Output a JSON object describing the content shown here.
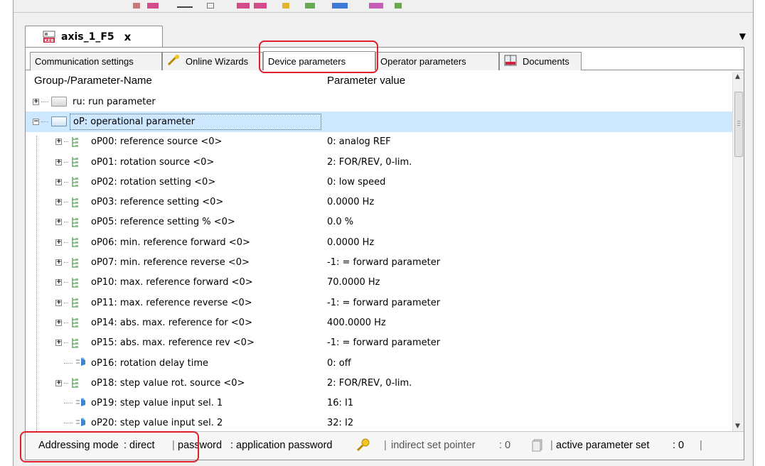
{
  "document_tab": {
    "title": "axis_1_F5",
    "close_glyph": "x",
    "dropdown_glyph": "▼",
    "logo_text": "KEB"
  },
  "subtabs": [
    {
      "label": "Communication settings",
      "icon": "none"
    },
    {
      "label": "Online Wizards",
      "icon": "wand-icon"
    },
    {
      "label": "Device parameters",
      "icon": "none",
      "active": true
    },
    {
      "label": "Operator parameters",
      "icon": "none"
    },
    {
      "label": "Documents",
      "icon": "keb-book-icon"
    }
  ],
  "grid": {
    "col_name": "Group-/Parameter-Name",
    "col_value": "Parameter value",
    "rows": [
      {
        "name": "ru: run parameter",
        "value": "",
        "kind": "group",
        "expanded": false
      },
      {
        "name": "oP: operational parameter",
        "value": "",
        "kind": "group",
        "expanded": true,
        "selected": true
      },
      {
        "name": "oP00: reference source <0>",
        "value": "0: analog REF",
        "kind": "param"
      },
      {
        "name": "oP01: rotation source <0>",
        "value": "2: FOR/REV, 0-lim.",
        "kind": "param"
      },
      {
        "name": "oP02: rotation setting <0>",
        "value": "0: low speed",
        "kind": "param"
      },
      {
        "name": "oP03: reference setting <0>",
        "value": "0.0000 Hz",
        "kind": "param"
      },
      {
        "name": "oP05: reference setting % <0>",
        "value": "0.0 %",
        "kind": "param"
      },
      {
        "name": "oP06: min. reference forward <0>",
        "value": "0.0000 Hz",
        "kind": "param"
      },
      {
        "name": "oP07: min. reference reverse <0>",
        "value": "-1: = forward parameter",
        "kind": "param"
      },
      {
        "name": "oP10: max. reference forward <0>",
        "value": "70.0000 Hz",
        "kind": "param"
      },
      {
        "name": "oP11: max. reference reverse <0>",
        "value": "-1: = forward parameter",
        "kind": "param"
      },
      {
        "name": "oP14: abs. max. reference for <0>",
        "value": "400.0000 Hz",
        "kind": "param"
      },
      {
        "name": "oP15: abs. max. reference rev <0>",
        "value": "-1: = forward parameter",
        "kind": "param"
      },
      {
        "name": "oP16: rotation delay time",
        "value": "0: off",
        "kind": "leaf"
      },
      {
        "name": "oP18: step value rot. source <0>",
        "value": "2: FOR/REV, 0-lim.",
        "kind": "param"
      },
      {
        "name": "oP19: step value input sel. 1",
        "value": "16: I1",
        "kind": "leaf"
      },
      {
        "name": "oP20: step value input sel. 2",
        "value": "32: I2",
        "kind": "leaf"
      }
    ]
  },
  "status": {
    "addressing_label": "Addressing mode",
    "addressing_value": ": direct",
    "password_label": "password",
    "password_value": ": application password",
    "indirect_label": "indirect set pointer",
    "indirect_value": ": 0",
    "active_label": "active parameter set",
    "active_value": ": 0"
  },
  "colors": {
    "highlight": "#e0202a",
    "selection": "#cde8ff"
  }
}
